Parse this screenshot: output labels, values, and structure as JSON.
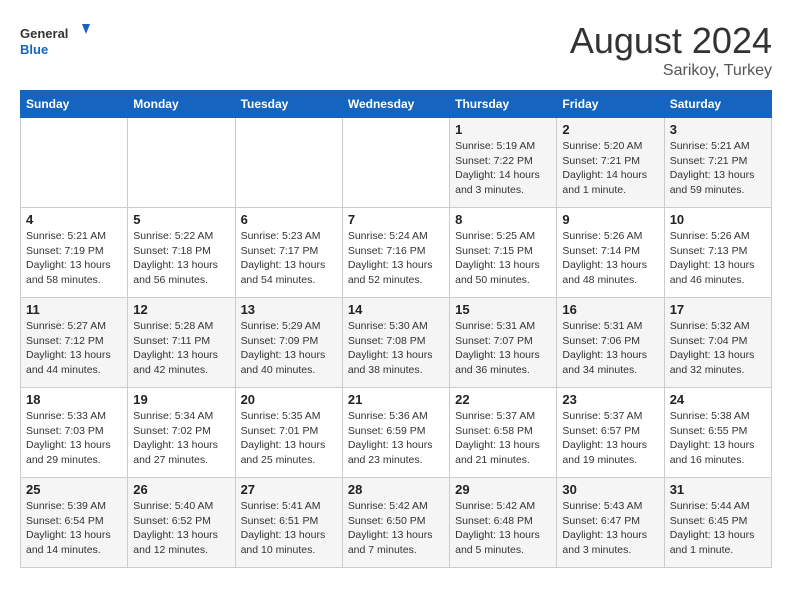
{
  "header": {
    "logo_line1": "General",
    "logo_line2": "Blue",
    "month_year": "August 2024",
    "location": "Sarikoy, Turkey"
  },
  "weekdays": [
    "Sunday",
    "Monday",
    "Tuesday",
    "Wednesday",
    "Thursday",
    "Friday",
    "Saturday"
  ],
  "weeks": [
    [
      {
        "day": "",
        "sunrise": "",
        "sunset": "",
        "daylight": ""
      },
      {
        "day": "",
        "sunrise": "",
        "sunset": "",
        "daylight": ""
      },
      {
        "day": "",
        "sunrise": "",
        "sunset": "",
        "daylight": ""
      },
      {
        "day": "",
        "sunrise": "",
        "sunset": "",
        "daylight": ""
      },
      {
        "day": "1",
        "sunrise": "Sunrise: 5:19 AM",
        "sunset": "Sunset: 7:22 PM",
        "daylight": "Daylight: 14 hours and 3 minutes."
      },
      {
        "day": "2",
        "sunrise": "Sunrise: 5:20 AM",
        "sunset": "Sunset: 7:21 PM",
        "daylight": "Daylight: 14 hours and 1 minute."
      },
      {
        "day": "3",
        "sunrise": "Sunrise: 5:21 AM",
        "sunset": "Sunset: 7:21 PM",
        "daylight": "Daylight: 13 hours and 59 minutes."
      }
    ],
    [
      {
        "day": "4",
        "sunrise": "Sunrise: 5:21 AM",
        "sunset": "Sunset: 7:19 PM",
        "daylight": "Daylight: 13 hours and 58 minutes."
      },
      {
        "day": "5",
        "sunrise": "Sunrise: 5:22 AM",
        "sunset": "Sunset: 7:18 PM",
        "daylight": "Daylight: 13 hours and 56 minutes."
      },
      {
        "day": "6",
        "sunrise": "Sunrise: 5:23 AM",
        "sunset": "Sunset: 7:17 PM",
        "daylight": "Daylight: 13 hours and 54 minutes."
      },
      {
        "day": "7",
        "sunrise": "Sunrise: 5:24 AM",
        "sunset": "Sunset: 7:16 PM",
        "daylight": "Daylight: 13 hours and 52 minutes."
      },
      {
        "day": "8",
        "sunrise": "Sunrise: 5:25 AM",
        "sunset": "Sunset: 7:15 PM",
        "daylight": "Daylight: 13 hours and 50 minutes."
      },
      {
        "day": "9",
        "sunrise": "Sunrise: 5:26 AM",
        "sunset": "Sunset: 7:14 PM",
        "daylight": "Daylight: 13 hours and 48 minutes."
      },
      {
        "day": "10",
        "sunrise": "Sunrise: 5:26 AM",
        "sunset": "Sunset: 7:13 PM",
        "daylight": "Daylight: 13 hours and 46 minutes."
      }
    ],
    [
      {
        "day": "11",
        "sunrise": "Sunrise: 5:27 AM",
        "sunset": "Sunset: 7:12 PM",
        "daylight": "Daylight: 13 hours and 44 minutes."
      },
      {
        "day": "12",
        "sunrise": "Sunrise: 5:28 AM",
        "sunset": "Sunset: 7:11 PM",
        "daylight": "Daylight: 13 hours and 42 minutes."
      },
      {
        "day": "13",
        "sunrise": "Sunrise: 5:29 AM",
        "sunset": "Sunset: 7:09 PM",
        "daylight": "Daylight: 13 hours and 40 minutes."
      },
      {
        "day": "14",
        "sunrise": "Sunrise: 5:30 AM",
        "sunset": "Sunset: 7:08 PM",
        "daylight": "Daylight: 13 hours and 38 minutes."
      },
      {
        "day": "15",
        "sunrise": "Sunrise: 5:31 AM",
        "sunset": "Sunset: 7:07 PM",
        "daylight": "Daylight: 13 hours and 36 minutes."
      },
      {
        "day": "16",
        "sunrise": "Sunrise: 5:31 AM",
        "sunset": "Sunset: 7:06 PM",
        "daylight": "Daylight: 13 hours and 34 minutes."
      },
      {
        "day": "17",
        "sunrise": "Sunrise: 5:32 AM",
        "sunset": "Sunset: 7:04 PM",
        "daylight": "Daylight: 13 hours and 32 minutes."
      }
    ],
    [
      {
        "day": "18",
        "sunrise": "Sunrise: 5:33 AM",
        "sunset": "Sunset: 7:03 PM",
        "daylight": "Daylight: 13 hours and 29 minutes."
      },
      {
        "day": "19",
        "sunrise": "Sunrise: 5:34 AM",
        "sunset": "Sunset: 7:02 PM",
        "daylight": "Daylight: 13 hours and 27 minutes."
      },
      {
        "day": "20",
        "sunrise": "Sunrise: 5:35 AM",
        "sunset": "Sunset: 7:01 PM",
        "daylight": "Daylight: 13 hours and 25 minutes."
      },
      {
        "day": "21",
        "sunrise": "Sunrise: 5:36 AM",
        "sunset": "Sunset: 6:59 PM",
        "daylight": "Daylight: 13 hours and 23 minutes."
      },
      {
        "day": "22",
        "sunrise": "Sunrise: 5:37 AM",
        "sunset": "Sunset: 6:58 PM",
        "daylight": "Daylight: 13 hours and 21 minutes."
      },
      {
        "day": "23",
        "sunrise": "Sunrise: 5:37 AM",
        "sunset": "Sunset: 6:57 PM",
        "daylight": "Daylight: 13 hours and 19 minutes."
      },
      {
        "day": "24",
        "sunrise": "Sunrise: 5:38 AM",
        "sunset": "Sunset: 6:55 PM",
        "daylight": "Daylight: 13 hours and 16 minutes."
      }
    ],
    [
      {
        "day": "25",
        "sunrise": "Sunrise: 5:39 AM",
        "sunset": "Sunset: 6:54 PM",
        "daylight": "Daylight: 13 hours and 14 minutes."
      },
      {
        "day": "26",
        "sunrise": "Sunrise: 5:40 AM",
        "sunset": "Sunset: 6:52 PM",
        "daylight": "Daylight: 13 hours and 12 minutes."
      },
      {
        "day": "27",
        "sunrise": "Sunrise: 5:41 AM",
        "sunset": "Sunset: 6:51 PM",
        "daylight": "Daylight: 13 hours and 10 minutes."
      },
      {
        "day": "28",
        "sunrise": "Sunrise: 5:42 AM",
        "sunset": "Sunset: 6:50 PM",
        "daylight": "Daylight: 13 hours and 7 minutes."
      },
      {
        "day": "29",
        "sunrise": "Sunrise: 5:42 AM",
        "sunset": "Sunset: 6:48 PM",
        "daylight": "Daylight: 13 hours and 5 minutes."
      },
      {
        "day": "30",
        "sunrise": "Sunrise: 5:43 AM",
        "sunset": "Sunset: 6:47 PM",
        "daylight": "Daylight: 13 hours and 3 minutes."
      },
      {
        "day": "31",
        "sunrise": "Sunrise: 5:44 AM",
        "sunset": "Sunset: 6:45 PM",
        "daylight": "Daylight: 13 hours and 1 minute."
      }
    ]
  ]
}
